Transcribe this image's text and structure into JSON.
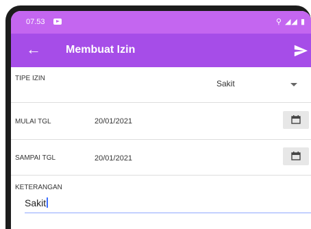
{
  "status_bar": {
    "time": "07.53"
  },
  "app_bar": {
    "title": "Membuat Izin"
  },
  "form": {
    "tipe_izin": {
      "label": "TIPE IZIN",
      "value": "Sakit"
    },
    "mulai_tgl": {
      "label": "MULAI TGL",
      "value": "20/01/2021"
    },
    "sampai_tgl": {
      "label": "SAMPAI TGL",
      "value": "20/01/2021"
    },
    "keterangan": {
      "label": "KETERANGAN",
      "value": "Sakit"
    }
  },
  "colors": {
    "status_bar": "#c466f0",
    "app_bar": "#a64de8",
    "input_underline": "#8fa8ff"
  },
  "icons": [
    "back-arrow-icon",
    "send-icon",
    "dropdown-caret-icon",
    "calendar-icon",
    "wifi-icon",
    "signal-icon",
    "battery-icon"
  ]
}
